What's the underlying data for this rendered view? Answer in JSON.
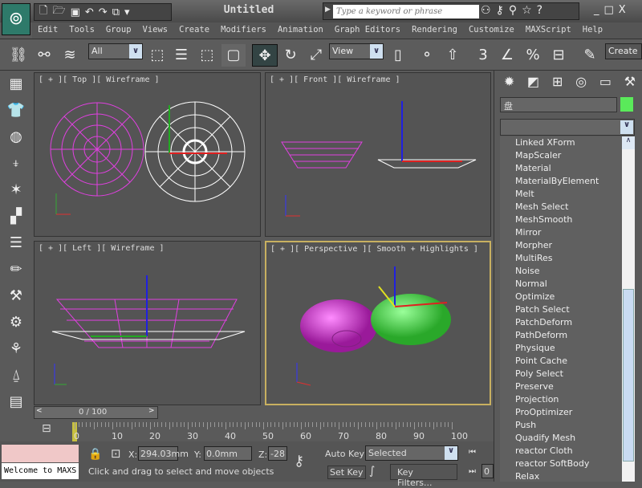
{
  "app": {
    "title": "Untitled",
    "logo": "3ds-max-logo"
  },
  "quick_access": [
    "new-icon",
    "open-icon",
    "save-icon",
    "undo-icon",
    "redo-icon",
    "project-icon"
  ],
  "search": {
    "placeholder": "Type a keyword or phrase"
  },
  "menu": [
    "Edit",
    "Tools",
    "Group",
    "Views",
    "Create",
    "Modifiers",
    "Animation",
    "Graph Editors",
    "Rendering",
    "Customize",
    "MAXScript",
    "Help"
  ],
  "toolbar": {
    "selection_filter": "All",
    "reference_coord": "View",
    "create_selection_set": "Create"
  },
  "viewports": [
    {
      "label": "[ + ][ Top ][ Wireframe ]"
    },
    {
      "label": "[ + ][ Front ][ Wireframe ]"
    },
    {
      "label": "[ + ][ Left ][ Wireframe ]"
    },
    {
      "label": "[ + ][ Perspective ][ Smooth + Highlights ]",
      "active": true
    }
  ],
  "colors": {
    "object_pink": "#e040e0",
    "object_green": "#40e040",
    "active_border": "#c8b060",
    "axis_x": "#e02020",
    "axis_y": "#e0e020",
    "axis_z": "#2020e0"
  },
  "time": {
    "slider": "0 / 100",
    "ticks": [
      "0",
      "10",
      "20",
      "30",
      "40",
      "50",
      "60",
      "70",
      "80",
      "90",
      "100"
    ]
  },
  "status": {
    "welcome": "Welcome to MAXS",
    "prompt": "Click and drag to select and move objects",
    "x": "294.03mm",
    "y": "0.0mm",
    "z": "-28",
    "x_label": "X:",
    "y_label": "Y:",
    "z_label": "Z:",
    "auto_key": "Auto Key",
    "key_mode": "Selected",
    "set_key": "Set Key",
    "key_filters": "Key Filters...",
    "frame": "0"
  },
  "command_panel": {
    "object_name": "盘",
    "object_color": "#5aea5a",
    "tabs": [
      "create-icon",
      "modify-icon",
      "hierarchy-icon",
      "motion-icon",
      "display-icon",
      "utilities-icon"
    ],
    "modifiers": [
      "Linked XForm",
      "MapScaler",
      "Material",
      "MaterialByElement",
      "Melt",
      "Mesh Select",
      "MeshSmooth",
      "Mirror",
      "Morpher",
      "MultiRes",
      "Noise",
      "Normal",
      "Optimize",
      "Patch Select",
      "PatchDeform",
      "PathDeform",
      "Physique",
      "Point Cache",
      "Poly Select",
      "Preserve",
      "Projection",
      "ProOptimizer",
      "Push",
      "Quadify Mesh",
      "reactor Cloth",
      "reactor SoftBody",
      "Relax"
    ]
  }
}
